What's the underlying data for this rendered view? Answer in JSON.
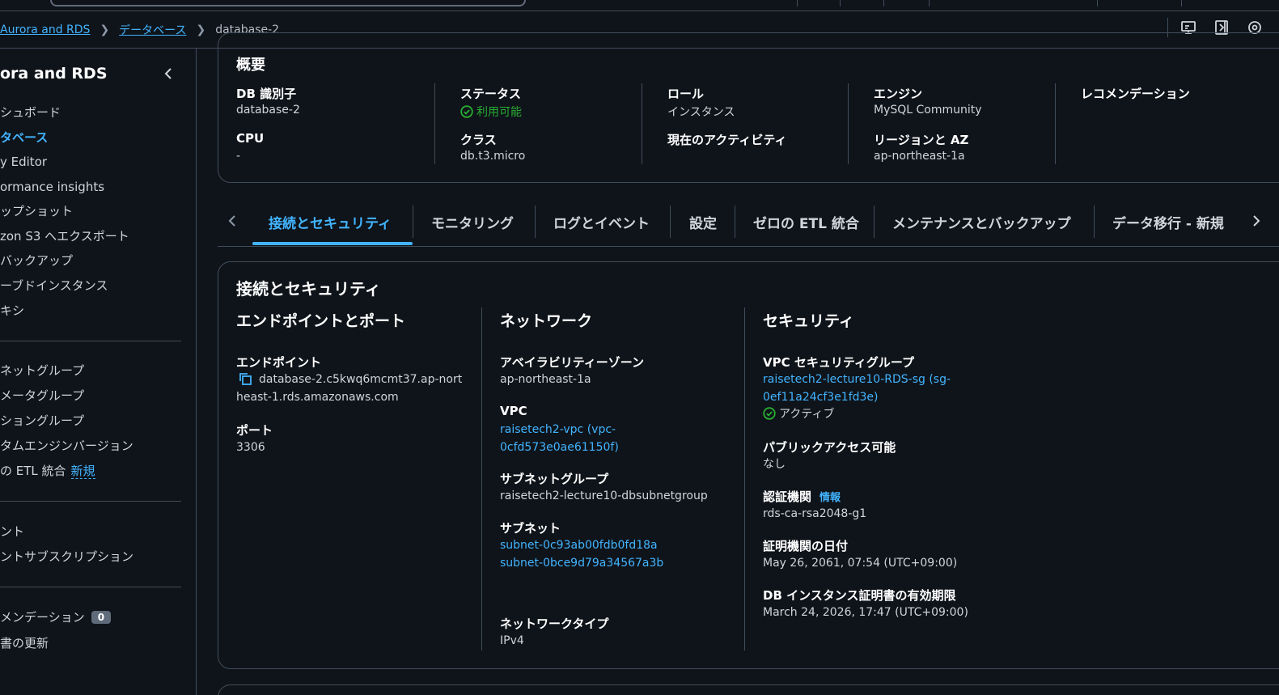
{
  "breadcrumb": {
    "root": "Aurora and RDS",
    "section": "データベース",
    "current": "database-2"
  },
  "sidebar": {
    "title": "ora and RDS",
    "items": [
      {
        "label": "シュボード"
      },
      {
        "label": "タベース"
      },
      {
        "label": "y Editor"
      },
      {
        "label": "ormance insights"
      },
      {
        "label": "ップショット"
      },
      {
        "label": "zon S3 へエクスポート"
      },
      {
        "label": "バックアップ"
      },
      {
        "label": "ーブドインスタンス"
      },
      {
        "label": "キシ"
      },
      {
        "label": "ネットグループ"
      },
      {
        "label": "メータグループ"
      },
      {
        "label": "ショングループ"
      },
      {
        "label": "タムエンジンバージョン"
      },
      {
        "label": "の ETL 統合",
        "tag": "新規"
      },
      {
        "label": "ント"
      },
      {
        "label": "ントサブスクリプション"
      },
      {
        "label": "メンデーション",
        "badge": "0"
      },
      {
        "label": "書の更新"
      }
    ]
  },
  "summary": {
    "title": "概要",
    "fields": {
      "db_id_label": "DB 識別子",
      "db_id": "database-2",
      "cpu_label": "CPU",
      "cpu": "-",
      "status_label": "ステータス",
      "status": "利用可能",
      "class_label": "クラス",
      "class": "db.t3.micro",
      "role_label": "ロール",
      "role": "インスタンス",
      "activity_label": "現在のアクティビティ",
      "engine_label": "エンジン",
      "engine": "MySQL Community",
      "region_label": "リージョンと AZ",
      "region": "ap-northeast-1a",
      "recommend_label": "レコメンデーション"
    }
  },
  "tabs": [
    {
      "label": "接続とセキュリティ",
      "active": true
    },
    {
      "label": "モニタリング"
    },
    {
      "label": "ログとイベント"
    },
    {
      "label": "設定"
    },
    {
      "label": "ゼロの ETL 統合"
    },
    {
      "label": "メンテナンスとバックアップ"
    },
    {
      "label": "データ移行 - 新規"
    }
  ],
  "connectivity": {
    "title": "接続とセキュリティ",
    "endpoint_section": {
      "title": "エンドポイントとポート",
      "endpoint_label": "エンドポイント",
      "endpoint_line1": "database-2.c5kwq6mcmt37.ap-nort",
      "endpoint_line2": "heast-1.rds.amazonaws.com",
      "port_label": "ポート",
      "port": "3306"
    },
    "network_section": {
      "title": "ネットワーク",
      "az_label": "アベイラビリティーゾーン",
      "az": "ap-northeast-1a",
      "vpc_label": "VPC",
      "vpc_line1": "raisetech2-vpc (vpc-",
      "vpc_line2": "0cfd573e0ae61150f)",
      "subnet_group_label": "サブネットグループ",
      "subnet_group": "raisetech2-lecture10-dbsubnetgroup",
      "subnets_label": "サブネット",
      "subnet1": "subnet-0c93ab00fdb0fd18a",
      "subnet2": "subnet-0bce9d79a34567a3b",
      "network_type_label": "ネットワークタイプ",
      "network_type": "IPv4"
    },
    "security_section": {
      "title": "セキュリティ",
      "sg_label": "VPC セキュリティグループ",
      "sg_line1": "raisetech2-lecture10-RDS-sg (sg-",
      "sg_line2": "0ef11a24cf3e1fd3e)",
      "sg_status": "アクティブ",
      "public_label": "パブリックアクセス可能",
      "public": "なし",
      "ca_label": "認証機関",
      "ca_info": "情報",
      "ca": "rds-ca-rsa2048-g1",
      "ca_date_label": "証明機関の日付",
      "ca_date": "May 26, 2061, 07:54 (UTC+09:00)",
      "cert_expiry_label": "DB インスタンス証明書の有効期限",
      "cert_expiry": "March 24, 2026, 17:47 (UTC+09:00)"
    }
  },
  "colors": {
    "background": "#0f141a",
    "link": "#42b4ff",
    "success": "#29ad32",
    "border": "#414d5c"
  }
}
